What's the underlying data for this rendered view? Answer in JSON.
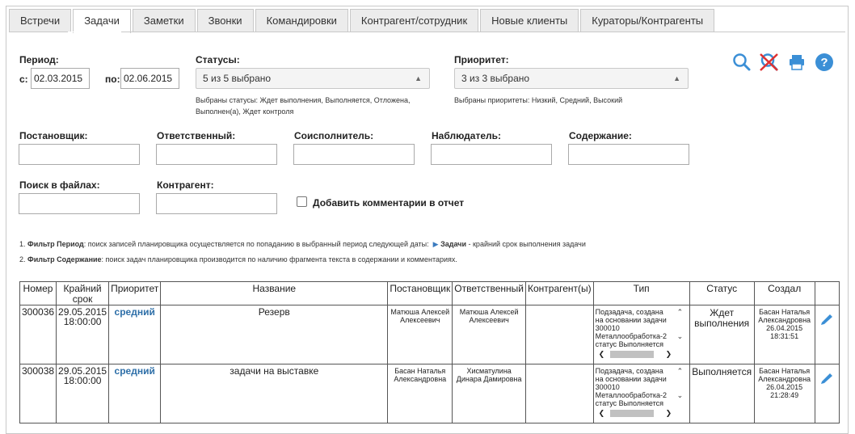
{
  "tabs": [
    "Встречи",
    "Задачи",
    "Заметки",
    "Звонки",
    "Командировки",
    "Контрагент/сотрудник",
    "Новые клиенты",
    "Кураторы/Контрагенты"
  ],
  "active_tab": "Задачи",
  "filters": {
    "period_label": "Период:",
    "from_label": "с:",
    "from_value": "02.03.2015",
    "to_label": "по:",
    "to_value": "02.06.2015",
    "statuses_label": "Статусы:",
    "statuses_value": "5 из 5 выбрано",
    "statuses_hint": "Выбраны статусы: Ждет выполнения, Выполняется, Отложена, Выполнен(а), Ждет контроля",
    "priority_label": "Приоритет:",
    "priority_value": "3 из 3 выбрано",
    "priority_hint": "Выбраны приоритеты: Низкий, Средний, Высокий",
    "assigner_label": "Постановщик:",
    "responsible_label": "Ответственный:",
    "coexecutor_label": "Соисполнитель:",
    "observer_label": "Наблюдатель:",
    "content_label": "Содержание:",
    "files_label": "Поиск в файлах:",
    "counterparty_label": "Контрагент:",
    "add_comments_label": "Добавить комментарии в отчет"
  },
  "toolbar_icons": [
    "search-icon",
    "clear-filter-icon",
    "print-icon",
    "help-icon"
  ],
  "notes": {
    "note1_prefix": "1. ",
    "note1_bold": "Фильтр Период",
    "note1_text": ": поиск записей планировщика осуществляется по попаданию в выбранный период следующей даты:",
    "note1_item_bold": "Задачи",
    "note1_item_text": " - крайний срок выполнения задачи",
    "note2_prefix": "2. ",
    "note2_bold": "Фильтр Содержание",
    "note2_text": ": поиск задач планировщика производится по наличию фрагмента текста в содержании и комментариях."
  },
  "table": {
    "columns": [
      "Номер",
      "Крайний срок",
      "Приоритет",
      "Название",
      "Постановщик",
      "Ответственный",
      "Контрагент(ы)",
      "Тип",
      "Статус",
      "Создал",
      ""
    ],
    "rows": [
      {
        "number": "300036",
        "deadline_date": "29.05.2015",
        "deadline_time": "18:00:00",
        "priority": "средний",
        "title": "Резерв",
        "assigner": "Матюша Алексей Алексеевич",
        "responsible": "Матюша Алексей Алексеевич",
        "counterparty": "",
        "type": "Подзадача, создана на основании задачи 300010 Металлообработка-2 статус Выполняется",
        "status": "Ждет выполнения",
        "creator": "Басан Наталья Александровна",
        "created_date": "26.04.2015",
        "created_time": "18:31:51"
      },
      {
        "number": "300038",
        "deadline_date": "29.05.2015",
        "deadline_time": "18:00:00",
        "priority": "средний",
        "title": "задачи на выставке",
        "assigner": "Басан Наталья Александровна",
        "responsible": "Хисматулина Динара Дамировна",
        "counterparty": "",
        "type": "Подзадача, создана на основании задачи 300010 Металлообработка-2 статус Выполняется",
        "status": "Выполняется",
        "creator": "Басан Наталья Александровна",
        "created_date": "26.04.2015",
        "created_time": "21:28:49"
      }
    ]
  },
  "colors": {
    "accent_blue": "#2e6fa8",
    "icon_blue": "#3b8fd6",
    "clear_red": "#e03030"
  }
}
